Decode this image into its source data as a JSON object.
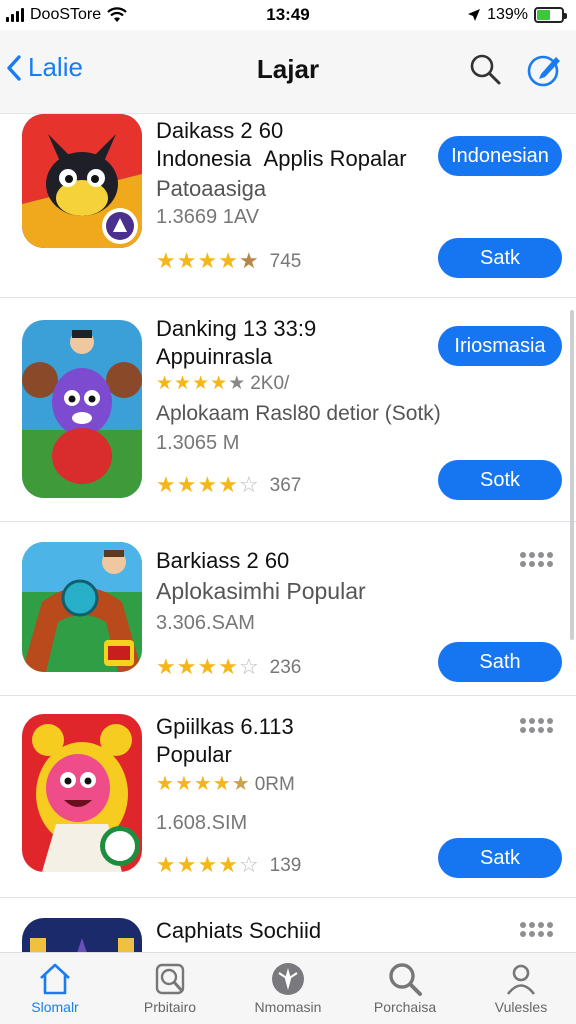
{
  "status": {
    "carrier": "DooSTore",
    "time": "13:49",
    "battery": "139%"
  },
  "nav": {
    "back_label": "Lalie",
    "title": "Lajar"
  },
  "apps": [
    {
      "title1": "Daikass 2 60",
      "title2a": "Indonesia",
      "title2b": "Applis Ropalar",
      "subtitle": "Patoaasiga",
      "size": "1.3669 1AV",
      "rating": 4.5,
      "count": "745",
      "top_button": "Indonesian",
      "button": "Satk"
    },
    {
      "title1": "Danking 13 33:9",
      "title2": "Appuinrasla",
      "inline_rating": 4.5,
      "inline_count": "2K0/",
      "subtitle": "Aplokaam Rasl80 detior (Sotk)",
      "size": "1.3065 M",
      "rating": 3.5,
      "count": "367",
      "top_button": "Iriosmasia",
      "button": "Sotk"
    },
    {
      "title1": "Barkiass 2 60",
      "title2": "Aplokasimhi Popular",
      "size": "3.306.SAM",
      "rating": 4,
      "count": "236",
      "button": "Sath"
    },
    {
      "title1": "Gpiilkas 6.113",
      "title2": "Popular",
      "inline_rating": 4.5,
      "inline_count": "0RM",
      "size": "1.608.SIM",
      "rating": 4,
      "count": "139",
      "button": "Satk"
    },
    {
      "title1": "Caphiats Sochiid"
    }
  ],
  "tabs": [
    {
      "label": "Slomalr",
      "icon": "home-icon"
    },
    {
      "label": "Prbitairo",
      "icon": "search-doc-icon"
    },
    {
      "label": "Nmomasin",
      "icon": "compass-icon"
    },
    {
      "label": "Porchaisa",
      "icon": "search-icon"
    },
    {
      "label": "Vulesles",
      "icon": "person-icon"
    }
  ]
}
